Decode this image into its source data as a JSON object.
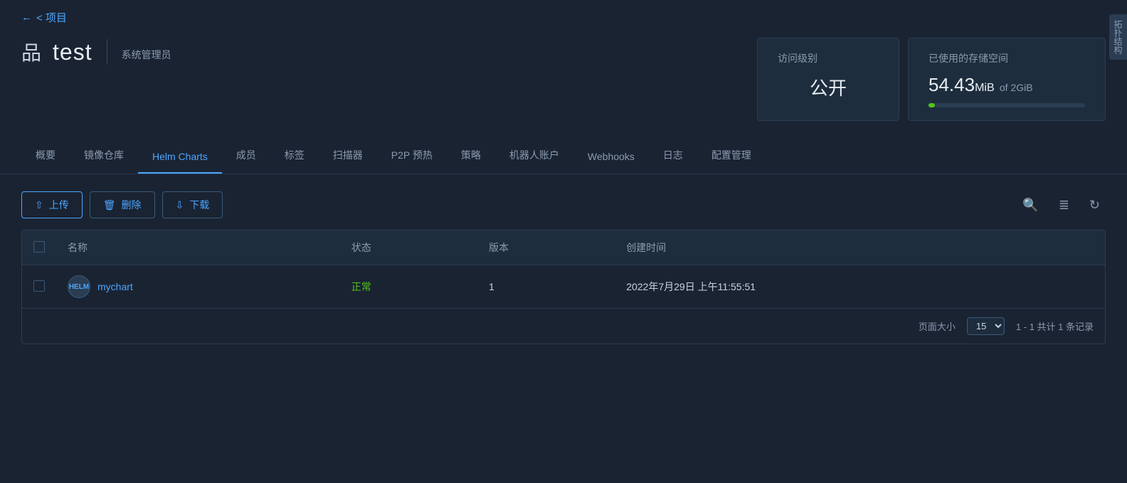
{
  "back": {
    "label": "< 项目"
  },
  "project": {
    "icon": "品",
    "name": "test",
    "role": "系统管理员"
  },
  "access_card": {
    "title": "访问级别",
    "value": "公开"
  },
  "storage_card": {
    "title": "已使用的存储空间",
    "used": "54.43",
    "unit": "MiB",
    "of_label": "of",
    "total": "2GiB",
    "percent": 4
  },
  "tabs": [
    {
      "id": "overview",
      "label": "概要",
      "active": false
    },
    {
      "id": "registry",
      "label": "镜像仓库",
      "active": false
    },
    {
      "id": "helm",
      "label": "Helm Charts",
      "active": true
    },
    {
      "id": "members",
      "label": "成员",
      "active": false
    },
    {
      "id": "tags",
      "label": "标签",
      "active": false
    },
    {
      "id": "scanner",
      "label": "扫描器",
      "active": false
    },
    {
      "id": "p2p",
      "label": "P2P 预热",
      "active": false
    },
    {
      "id": "policy",
      "label": "策略",
      "active": false
    },
    {
      "id": "robot",
      "label": "机器人账户",
      "active": false
    },
    {
      "id": "webhooks",
      "label": "Webhooks",
      "active": false
    },
    {
      "id": "logs",
      "label": "日志",
      "active": false
    },
    {
      "id": "config",
      "label": "配置管理",
      "active": false
    }
  ],
  "toolbar": {
    "upload_label": "上传",
    "delete_label": "删除",
    "download_label": "下载"
  },
  "table": {
    "columns": {
      "name": "名称",
      "status": "状态",
      "version": "版本",
      "created": "创建时间"
    },
    "rows": [
      {
        "name": "mychart",
        "status": "正常",
        "version": "1",
        "created": "2022年7月29日 上午11:55:51"
      }
    ]
  },
  "pagination": {
    "page_size_label": "页面大小",
    "page_size": "15",
    "summary": "1 - 1 共计 1 条记录"
  },
  "right_panel": {
    "label": "拓扑结构"
  }
}
